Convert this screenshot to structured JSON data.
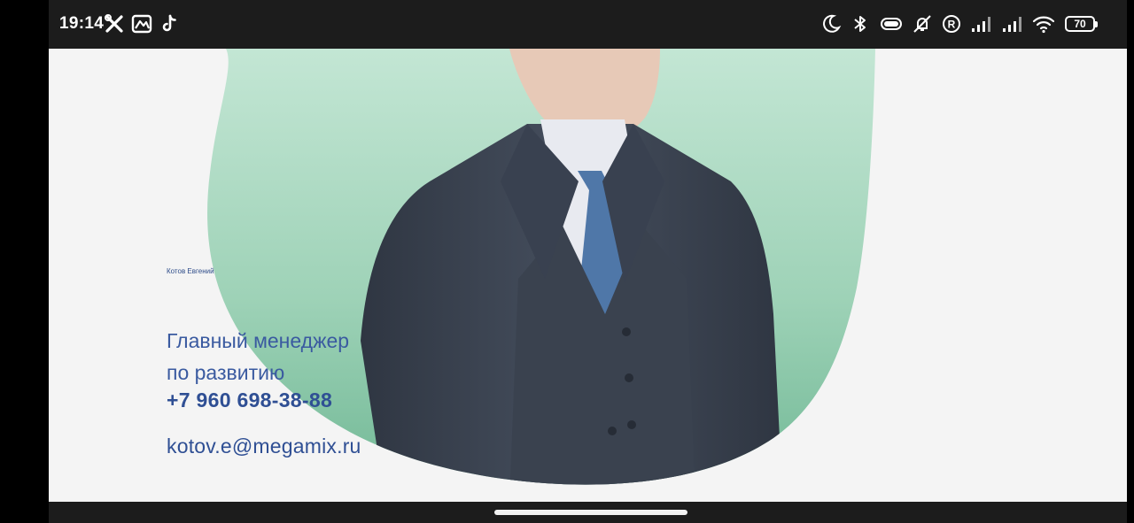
{
  "status_bar": {
    "time": "19:14",
    "left_icons": [
      "tools-icon",
      "gallery-icon",
      "tiktok-icon"
    ],
    "right_icons": [
      "moon-icon",
      "bluetooth-icon",
      "vibrate-icon",
      "mute-icon",
      "roaming-icon",
      "signal-icon",
      "signal-icon",
      "wifi-icon"
    ],
    "battery_level": "70"
  },
  "card": {
    "name": "Котов Евгений",
    "title_line1": "Главный менеджер",
    "title_line2": "по развитию",
    "phone": "+7 960 698-38-88",
    "email": "kotov.e@megamix.ru"
  },
  "colors": {
    "accent_text": "#2f4f94",
    "blob_top": "#b8e0cc",
    "blob_bottom": "#6fb794",
    "suit": "#3b4352"
  }
}
